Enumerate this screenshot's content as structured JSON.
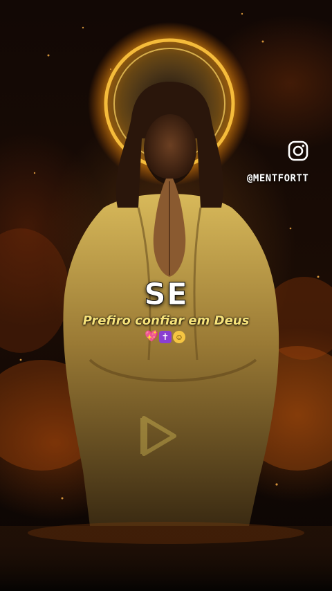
{
  "social": {
    "icon": "instagram-icon",
    "handle": "@MENTFORTT"
  },
  "caption": {
    "title": "SE",
    "subtitle": "Prefiro confiar em Deus"
  },
  "emojis": [
    {
      "icon": "sparkling-heart-icon",
      "glyph": "💖"
    },
    {
      "icon": "latin-cross-icon",
      "glyph": "✝"
    },
    {
      "icon": "relieved-face-icon",
      "glyph": "☺"
    }
  ],
  "overlay": {
    "icon": "play-icon"
  },
  "colors": {
    "subtitle": "#f6e27a",
    "halo": "#ffb52e",
    "fire": "#e0701a",
    "robe": "#c9a64a"
  }
}
